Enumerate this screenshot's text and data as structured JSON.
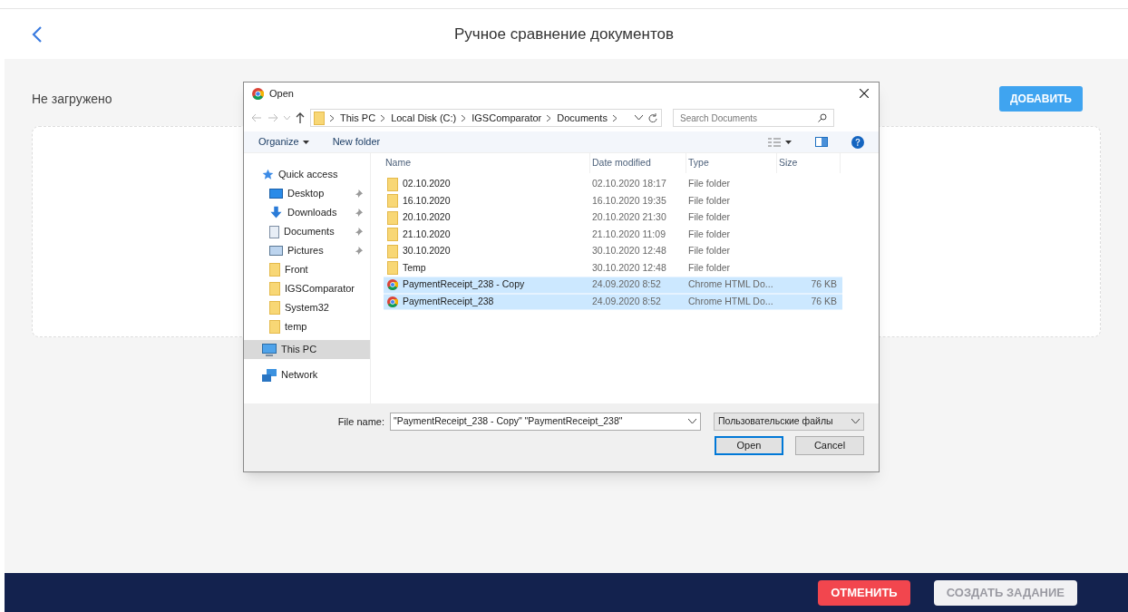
{
  "header": {
    "title": "Ручное сравнение документов"
  },
  "upload": {
    "status": "Не загружено",
    "add_button": "ДОБАВИТЬ"
  },
  "dialog": {
    "title": "Open",
    "breadcrumb": [
      "This PC",
      "Local Disk (C:)",
      "IGSComparator",
      "Documents"
    ],
    "search": {
      "placeholder": "Search Documents"
    },
    "toolbar": [
      "Organize",
      "New folder"
    ],
    "nav": [
      {
        "label": "Quick access",
        "kind": "star",
        "selected": false,
        "children": [
          {
            "label": "Desktop",
            "kind": "desktop",
            "selected": false,
            "pinned": true
          },
          {
            "label": "Downloads",
            "kind": "downloads",
            "selected": false,
            "pinned": true
          },
          {
            "label": "Documents",
            "kind": "documents",
            "selected": false,
            "pinned": true
          },
          {
            "label": "Pictures",
            "kind": "pictures",
            "selected": false,
            "pinned": true
          },
          {
            "label": "Front",
            "kind": "folder",
            "selected": false,
            "pinned": false
          },
          {
            "label": "IGSComparator",
            "kind": "folder",
            "selected": false,
            "pinned": false
          },
          {
            "label": "System32",
            "kind": "folder",
            "selected": false,
            "pinned": false
          },
          {
            "label": "temp",
            "kind": "folder",
            "selected": false,
            "pinned": false
          }
        ]
      },
      {
        "label": "This PC",
        "kind": "pc",
        "selected": true
      },
      {
        "label": "Network",
        "kind": "network",
        "selected": false
      }
    ],
    "columns": [
      "Name",
      "Date modified",
      "Type",
      "Size"
    ],
    "rows": [
      {
        "kind": "folder",
        "name": "02.10.2020",
        "date": "02.10.2020 18:17",
        "type": "File folder",
        "selected": false
      },
      {
        "kind": "folder",
        "name": "16.10.2020",
        "date": "16.10.2020 19:35",
        "type": "File folder",
        "selected": false
      },
      {
        "kind": "folder",
        "name": "20.10.2020",
        "date": "20.10.2020 21:30",
        "type": "File folder",
        "selected": false
      },
      {
        "kind": "folder",
        "name": "21.10.2020",
        "date": "21.10.2020 11:09",
        "type": "File folder",
        "selected": false
      },
      {
        "kind": "folder",
        "name": "30.10.2020",
        "date": "30.10.2020 12:48",
        "type": "File folder",
        "selected": false
      },
      {
        "kind": "folder",
        "name": "Temp",
        "date": "30.10.2020 12:48",
        "type": "File folder",
        "selected": false
      },
      {
        "kind": "html",
        "name": "PaymentReceipt_238 - Copy",
        "date": "24.09.2020 8:52",
        "type": "Chrome HTML Do...",
        "size": "76 KB",
        "selected": true
      },
      {
        "kind": "html",
        "name": "PaymentReceipt_238",
        "date": "24.09.2020 8:52",
        "type": "Chrome HTML Do...",
        "size": "76 KB",
        "selected": true
      }
    ],
    "file_name": {
      "label": "File name:",
      "value": "\"PaymentReceipt_238 - Copy\" \"PaymentReceipt_238\""
    },
    "file_type": "Пользовательские файлы",
    "buttons": [
      "Open",
      "Cancel"
    ]
  },
  "footer": {
    "buttons": [
      {
        "label": "ОТМЕНИТЬ",
        "kind": "danger",
        "disabled": false
      },
      {
        "label": "СОЗДАТЬ ЗАДАНИЕ",
        "kind": "primary",
        "disabled": true
      }
    ]
  }
}
